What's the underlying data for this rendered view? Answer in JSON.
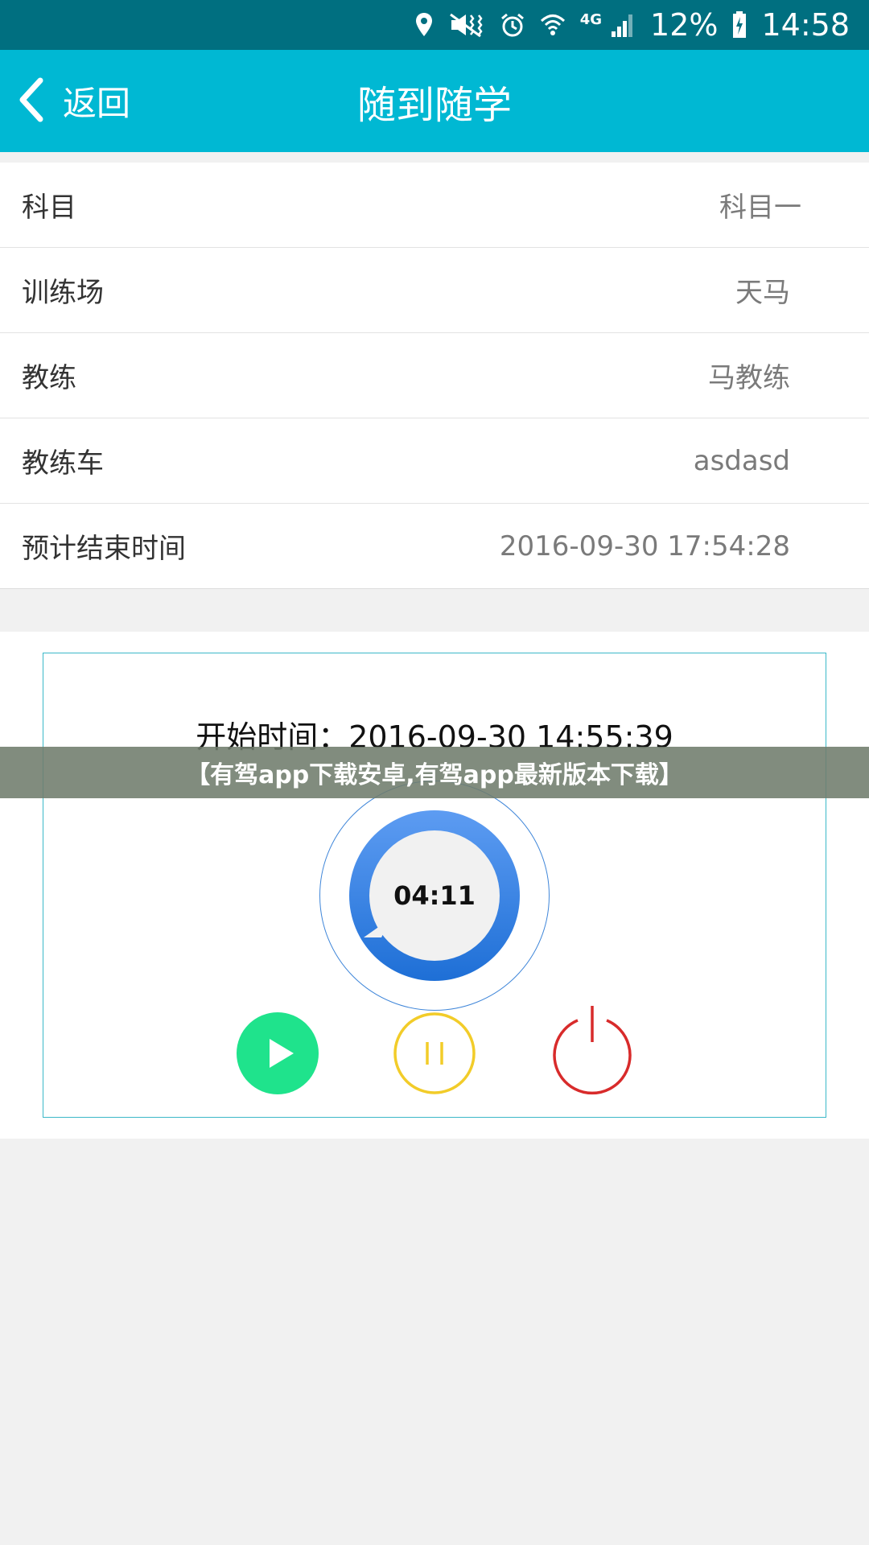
{
  "status_bar": {
    "network": "4G",
    "battery": "12%",
    "time": "14:58",
    "icons": [
      "location-icon",
      "mute-icon",
      "alarm-icon",
      "wifi-icon",
      "signal-icon",
      "battery-charging-icon"
    ]
  },
  "toolbar": {
    "back_label": "返回",
    "title": "随到随学",
    "color": "#00b8d3"
  },
  "info": [
    {
      "label": "科目",
      "value": "科目一"
    },
    {
      "label": "训练场",
      "value": "天马"
    },
    {
      "label": "教练",
      "value": "马教练"
    },
    {
      "label": "教练车",
      "value": "asdasd"
    },
    {
      "label": "预计结束时间",
      "value": "2016-09-30 17:54:28"
    }
  ],
  "timer": {
    "start_label": "开始时间：",
    "start_value": "2016-09-30 14:55:39",
    "elapsed": "04:11",
    "controls": [
      {
        "name": "play",
        "icon": "play-icon",
        "color": "#1fe38c"
      },
      {
        "name": "pause",
        "icon": "pause-icon",
        "color": "#f2cc29"
      },
      {
        "name": "stop",
        "icon": "power-icon",
        "color": "#d82b2b"
      }
    ]
  },
  "banner": {
    "text": "【有驾app下载安卓,有驾app最新版本下载】"
  }
}
